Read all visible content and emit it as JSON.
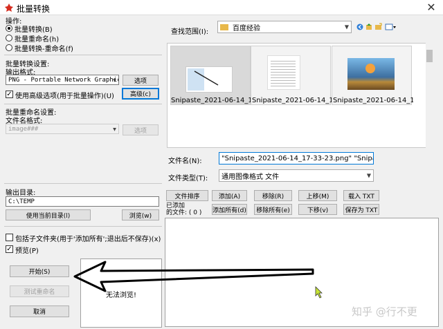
{
  "window": {
    "title": "批量转换"
  },
  "operation": {
    "label": "操作:",
    "options": [
      "批量转换(B)",
      "批量重命名(h)",
      "批量转换-重命名(f)"
    ]
  },
  "convert_settings": {
    "label": "批量转换设置:",
    "format_label": "输出格式:",
    "format_value": "PNG - Portable Network Graphics",
    "options_button": "选项",
    "advanced_checkbox": "使用高级选项(用于批量操作)(U)",
    "advanced_button": "高级(c)"
  },
  "rename_settings": {
    "label": "批量重命名设置:",
    "filename_label": "文件名格式:",
    "filename_value": "image###",
    "options_button": "选项"
  },
  "output": {
    "label": "输出目录:",
    "path": "C:\\TEMP",
    "use_current_button": "使用当前目录(l)",
    "browse_button": "浏览(w)"
  },
  "options": {
    "subfolders": "包括子文件夹(用于'添加所有';退出后不保存)(x)",
    "preview": "预览(P)"
  },
  "actions": {
    "start": "开始(S)",
    "test_rename": "测试重命名",
    "cancel": "取消"
  },
  "preview_text": "无法浏览!",
  "browser": {
    "lookin_label": "查找范围(I):",
    "lookin_value": "百度经验",
    "thumbnails": [
      "Snipaste_2021-06-14_1...",
      "Snipaste_2021-06-14_1...",
      "Snipaste_2021-06-14_1..."
    ],
    "filename_label": "文件名(N):",
    "filename_value": "\"Snipaste_2021-06-14_17-33-23.png\" \"Snipaste",
    "filetype_label": "文件类型(T):",
    "filetype_value": "通用图像格式 文件"
  },
  "list_buttons": {
    "sort": "文件排序",
    "add": "添加(A)",
    "remove": "移除(R)",
    "up": "上移(M)",
    "load_txt": "载入 TXT",
    "added_label": "已添加\n的文件: ( 0 )",
    "add_all": "添加所有(d)",
    "remove_all": "移除所有(e)",
    "down": "下移(v)",
    "save_txt": "保存为 TXT"
  },
  "watermark": "知乎 @行不更",
  "colors": {
    "accent": "#0078d7",
    "folder": "#e8b84a",
    "arrow": "#000000"
  }
}
